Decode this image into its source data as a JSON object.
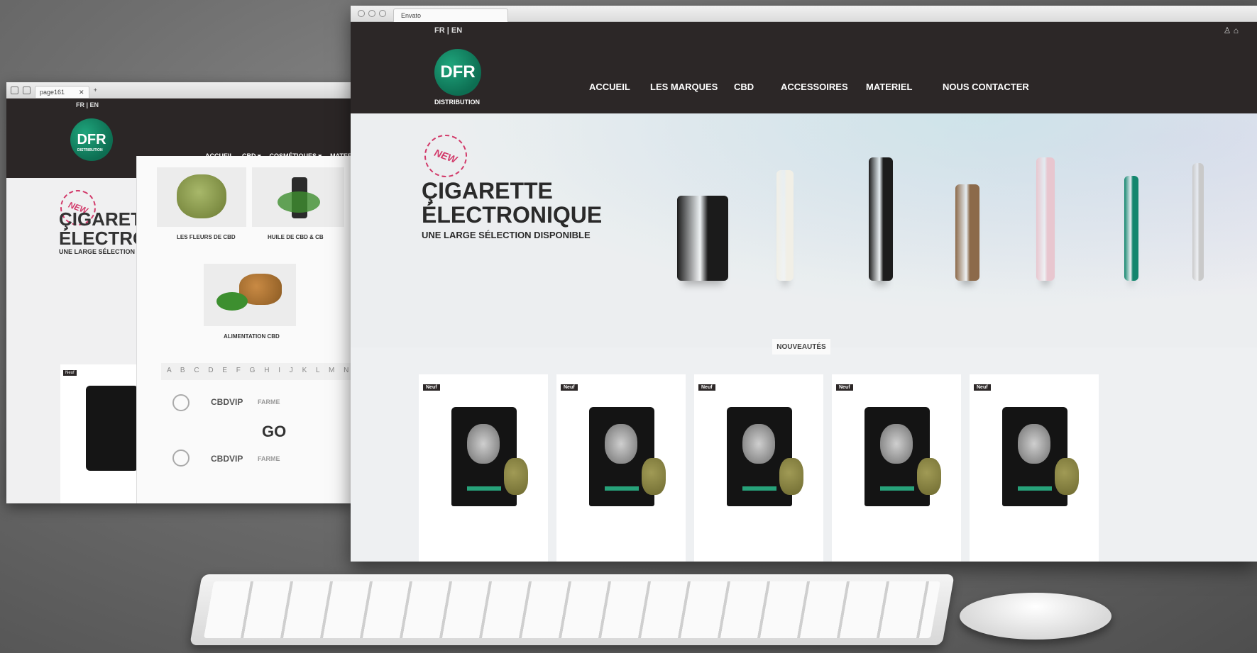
{
  "back_window": {
    "tab_title": "page161",
    "lang": "FR | EN",
    "logo": {
      "mark": "DFR",
      "sub": "DISTRIBUTION"
    },
    "nav": [
      "ACCUEIL",
      "CBD ▾",
      "COSMÉTIQUES ▾",
      "MATER"
    ],
    "hero": {
      "badge": "NEW",
      "title_line1": "ÇIGARETT",
      "title_line2": "ÉLECTRON",
      "subtitle": "UNE LARGE SÉLECTION"
    },
    "categories": [
      "LES FLEURS DE CBD",
      "HUILE DE CBD & CB",
      "ALIMENTATION CBD"
    ],
    "alphabet": "A B C D E F G H I J K L M N O",
    "brands": [
      "CBDVIP",
      "FARME",
      "GO",
      "CBDVIP",
      "FARME"
    ],
    "card_tag": "Neuf"
  },
  "front_window": {
    "tab_title": "Envato",
    "lang": "FR | EN",
    "account_icons": "♙ ⌂",
    "logo": {
      "mark": "DFR",
      "sub": "DISTRIBUTION"
    },
    "nav": [
      {
        "label": "ACCUEIL"
      },
      {
        "label": "LES MARQUES"
      },
      {
        "label": "CBD"
      },
      {
        "label": "ACCESSOIRES"
      },
      {
        "label": "MATERIEL"
      },
      {
        "label": "NOUS CONTACTER"
      }
    ],
    "hero": {
      "badge": "NEW",
      "title_line1": "ÇIGARETTE",
      "title_line2": "ÉLECTRONIQUE",
      "subtitle": "UNE LARGE SÉLECTION DISPONIBLE"
    },
    "section_title": "NOUVEAUTÉS",
    "products": [
      {
        "tag": "Neuf"
      },
      {
        "tag": "Neuf"
      },
      {
        "tag": "Neuf"
      },
      {
        "tag": "Neuf"
      },
      {
        "tag": "Neuf"
      }
    ],
    "vape_colors": [
      "#1b1b1b",
      "#f1efe6",
      "#1c1c1c",
      "#8c6a4a",
      "#e8c6cf",
      "#13866e",
      "#c9c9c9"
    ]
  }
}
